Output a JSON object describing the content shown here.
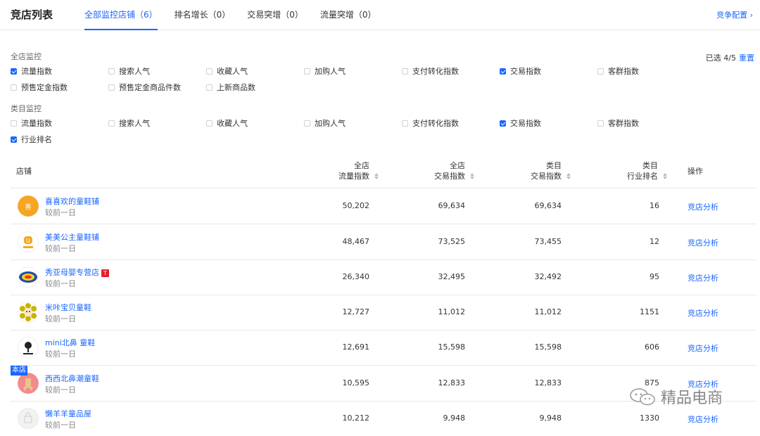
{
  "header": {
    "title": "竞店列表",
    "tabs": [
      {
        "label": "全部监控店铺（6）",
        "active": true
      },
      {
        "label": "排名增长（0）",
        "active": false
      },
      {
        "label": "交易突增（0）",
        "active": false
      },
      {
        "label": "流量突增（0）",
        "active": false
      }
    ],
    "config_link": "竞争配置 ›"
  },
  "filters": {
    "selected_text": "已选 4/5",
    "reset_label": "重置",
    "store_section": {
      "label": "全店监控",
      "options": [
        {
          "label": "流量指数",
          "checked": true
        },
        {
          "label": "搜索人气",
          "checked": false
        },
        {
          "label": "收藏人气",
          "checked": false
        },
        {
          "label": "加购人气",
          "checked": false
        },
        {
          "label": "支付转化指数",
          "checked": false
        },
        {
          "label": "交易指数",
          "checked": true
        },
        {
          "label": "客群指数",
          "checked": false
        },
        {
          "label": "预售定金指数",
          "checked": false
        },
        {
          "label": "预售定金商品件数",
          "checked": false
        },
        {
          "label": "上新商品数",
          "checked": false
        }
      ]
    },
    "category_section": {
      "label": "类目监控",
      "options": [
        {
          "label": "流量指数",
          "checked": false
        },
        {
          "label": "搜索人气",
          "checked": false
        },
        {
          "label": "收藏人气",
          "checked": false
        },
        {
          "label": "加购人气",
          "checked": false
        },
        {
          "label": "支付转化指数",
          "checked": false
        },
        {
          "label": "交易指数",
          "checked": true
        },
        {
          "label": "客群指数",
          "checked": false
        },
        {
          "label": "行业排名",
          "checked": true
        }
      ]
    }
  },
  "table": {
    "headers": {
      "shop": "店铺",
      "col1": [
        "全店",
        "流量指数"
      ],
      "col2": [
        "全店",
        "交易指数"
      ],
      "col3": [
        "类目",
        "交易指数"
      ],
      "col4": [
        "类目",
        "行业排名"
      ],
      "action": "操作"
    },
    "rows": [
      {
        "name": "喜喜欢的童鞋铺",
        "sub": "较前一日",
        "traffic": "50,202",
        "trade": "69,634",
        "cat_trade": "69,634",
        "rank": "16",
        "action": "竞店分析"
      },
      {
        "name": "美美公主童鞋铺",
        "sub": "较前一日",
        "traffic": "48,467",
        "trade": "73,525",
        "cat_trade": "73,455",
        "rank": "12",
        "action": "竞店分析"
      },
      {
        "name": "秀亚母婴专营店",
        "sub": "较前一日",
        "traffic": "26,340",
        "trade": "32,495",
        "cat_trade": "32,492",
        "rank": "95",
        "action": "竞店分析",
        "badge": "T"
      },
      {
        "name": "米咔宝贝童鞋",
        "sub": "较前一日",
        "traffic": "12,727",
        "trade": "11,012",
        "cat_trade": "11,012",
        "rank": "1151",
        "action": "竞店分析"
      },
      {
        "name": "mini北鼻 童鞋",
        "sub": "较前一日",
        "traffic": "12,691",
        "trade": "15,598",
        "cat_trade": "15,598",
        "rank": "606",
        "action": "竞店分析"
      },
      {
        "name": "西西北鼻潮童鞋",
        "sub": "较前一日",
        "traffic": "10,595",
        "trade": "12,833",
        "cat_trade": "12,833",
        "rank": "875",
        "action": "竞店分析",
        "own_badge": "本店"
      },
      {
        "name": "懒羊羊童品屋",
        "sub": "较前一日",
        "traffic": "10,212",
        "trade": "9,948",
        "cat_trade": "9,948",
        "rank": "1330",
        "action": "竞店分析"
      }
    ]
  },
  "watermark": {
    "text": "精品电商"
  },
  "colors": {
    "accent": "#1a66ff",
    "border": "#e8e8e8",
    "tmall_red": "#e61e2b"
  }
}
